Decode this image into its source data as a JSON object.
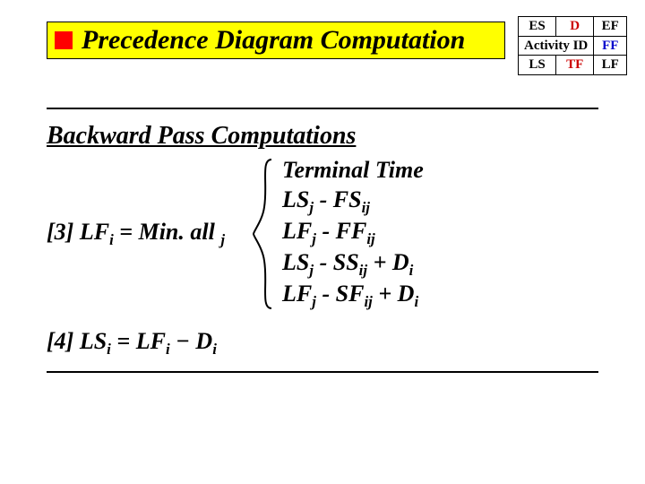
{
  "title": "Precedence Diagram Computation",
  "legend": {
    "rows": [
      {
        "c1": "ES",
        "c1_color": "black",
        "c2": "D",
        "c2_color": "red",
        "c3": "EF",
        "c3_color": "black",
        "c12_span": false
      },
      {
        "c12": "Activity ID",
        "c12_color": "black",
        "c3": "FF",
        "c3_color": "blue",
        "c12_span": true
      },
      {
        "c1": "LS",
        "c1_color": "black",
        "c2": "TF",
        "c2_color": "red",
        "c3": "LF",
        "c3_color": "black",
        "c12_span": false
      }
    ]
  },
  "section_title": "Backward Pass Computations",
  "eq3": {
    "label": "[3]",
    "lhs_sym": "LF",
    "lhs_sub": "i",
    "eq": " = ",
    "min_text": "Min. all",
    "min_sub": "j",
    "options": {
      "terminal": "Terminal Time",
      "l1_a": "LS",
      "l1_as": "j",
      "l1_m": " - FS",
      "l1_bs": "ij",
      "l2_a": "LF",
      "l2_as": "j",
      "l2_m": " - FF",
      "l2_bs": "ij",
      "l3_a": "LS",
      "l3_as": "j",
      "l3_m": " - SS",
      "l3_bs": "ij",
      "l3_t": " + D",
      "l3_ts": "i",
      "l4_a": "LF",
      "l4_as": "j",
      "l4_m": " - SF",
      "l4_bs": "ij",
      "l4_t": " + D",
      "l4_ts": "i"
    }
  },
  "eq4": {
    "label": "[4]",
    "a": "LS",
    "as": "i",
    "eq": " = ",
    "b": "LF",
    "bs": "i",
    "minus": " − ",
    "c": "D",
    "cs": "i"
  }
}
